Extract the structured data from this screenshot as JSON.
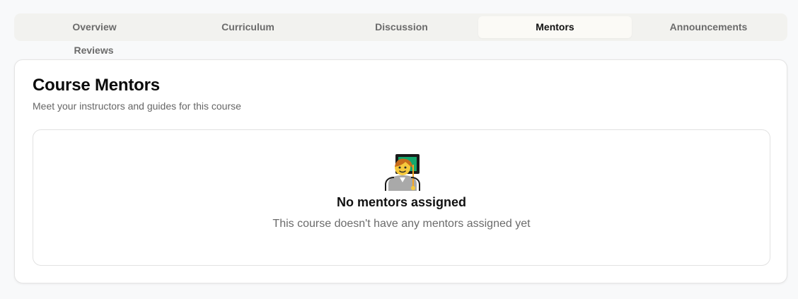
{
  "tabs": [
    {
      "label": "Overview",
      "active": false
    },
    {
      "label": "Curriculum",
      "active": false
    },
    {
      "label": "Discussion",
      "active": false
    },
    {
      "label": "Mentors",
      "active": true
    },
    {
      "label": "Announcements",
      "active": false
    },
    {
      "label": "Reviews",
      "active": false
    }
  ],
  "card": {
    "title": "Course Mentors",
    "subtitle": "Meet your instructors and guides for this course"
  },
  "empty_state": {
    "icon": "teacher-emoji-icon",
    "title": "No mentors assigned",
    "text": "This course doesn't have any mentors assigned yet"
  }
}
